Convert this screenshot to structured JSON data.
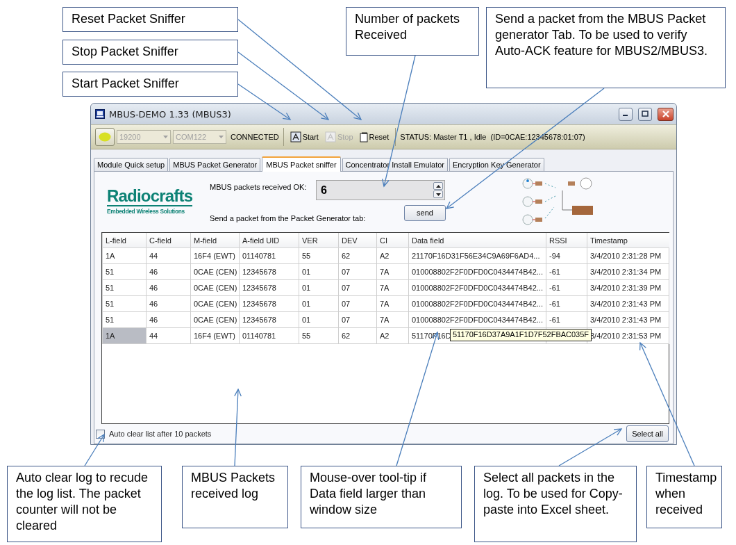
{
  "callouts": [
    {
      "text": "Reset Packet Sniffer"
    },
    {
      "text": "Stop Packet Sniffer"
    },
    {
      "text": "Start Packet Sniffer"
    },
    {
      "text": "Number of packets Received"
    },
    {
      "text": "Send a packet from the MBUS Packet generator Tab. To be used to verify Auto-ACK feature for MBUS2/MBUS3."
    },
    {
      "text": "Auto clear log to recude the log list. The packet counter will not be cleared"
    },
    {
      "text": "MBUS Packets received log"
    },
    {
      "text": "Mouse-over tool-tip if Data field larger than window size"
    },
    {
      "text": "Select all packets in the log. To be used for Copy-paste into Excel sheet."
    },
    {
      "text": "Timestamp when received"
    }
  ],
  "window": {
    "title": "MBUS-DEMO 1.33 (MBUS3)",
    "toolbar": {
      "baud": {
        "value": "19200",
        "disabled": true
      },
      "port": {
        "value": "COM122",
        "disabled": true
      },
      "connection": "CONNECTED",
      "buttons": [
        {
          "kind": "start",
          "label": "Start",
          "disabled": false
        },
        {
          "kind": "stop",
          "label": "Stop",
          "disabled": true
        },
        {
          "kind": "reset",
          "label": "Reset",
          "disabled": false
        }
      ],
      "status": "STATUS: Master T1 , Idle  (ID=0CAE:12345678:01:07)"
    },
    "tabs": [
      {
        "label": "Module Quick setup",
        "selected": false
      },
      {
        "label": "MBUS Packet Generator",
        "selected": false
      },
      {
        "label": "MBUS Packet sniffer",
        "selected": true
      },
      {
        "label": "Concentrator Install Emulator",
        "selected": false
      },
      {
        "label": "Encryption Key Generator",
        "selected": false
      }
    ],
    "panel": {
      "logo_name": "Radiocrafts",
      "logo_tagline": "Embedded Wireless Solutions",
      "count_label": "MBUS packets received OK:",
      "count": "6",
      "send_label": "Send a packet from the Packet Generator tab:",
      "send_button": "send"
    },
    "table": {
      "columns": [
        "L-field",
        "C-field",
        "M-field",
        "A-field UID",
        "VER",
        "DEV",
        "CI",
        "Data field",
        "RSSI",
        "Timestamp"
      ],
      "rows": [
        {
          "selected": false,
          "cells": [
            "1A",
            "44",
            "16F4 (EWT)",
            "01140781",
            "55",
            "62",
            "A2",
            "21170F16D31F56E34C9A69F6AD4...",
            "-94",
            "3/4/2010 2:31:28 PM"
          ]
        },
        {
          "selected": false,
          "cells": [
            "51",
            "46",
            "0CAE (CEN)",
            "12345678",
            "01",
            "07",
            "7A",
            "010008802F2F0DFD0C0434474B42...",
            "-61",
            "3/4/2010 2:31:34 PM"
          ]
        },
        {
          "selected": false,
          "cells": [
            "51",
            "46",
            "0CAE (CEN)",
            "12345678",
            "01",
            "07",
            "7A",
            "010008802F2F0DFD0C0434474B42...",
            "-61",
            "3/4/2010 2:31:39 PM"
          ]
        },
        {
          "selected": false,
          "cells": [
            "51",
            "46",
            "0CAE (CEN)",
            "12345678",
            "01",
            "07",
            "7A",
            "010008802F2F0DFD0C0434474B42...",
            "-61",
            "3/4/2010 2:31:43 PM"
          ]
        },
        {
          "selected": false,
          "cells": [
            "51",
            "46",
            "0CAE (CEN)",
            "12345678",
            "01",
            "07",
            "7A",
            "010008802F2F0DFD0C0434474B42...",
            "-61",
            "3/4/2010 2:31:43 PM"
          ]
        },
        {
          "selected": true,
          "cells": [
            "1A",
            "44",
            "16F4 (EWT)",
            "01140781",
            "55",
            "62",
            "A2",
            "51170F16D",
            null,
            "3/4/2010 2:31:53 PM"
          ]
        }
      ],
      "tooltip": "51170F16D37A9A1F1D7F52FBAC035F"
    },
    "auto_clear": {
      "label": "Auto clear list after 10 packets",
      "checked": false
    },
    "select_all": "Select all"
  }
}
